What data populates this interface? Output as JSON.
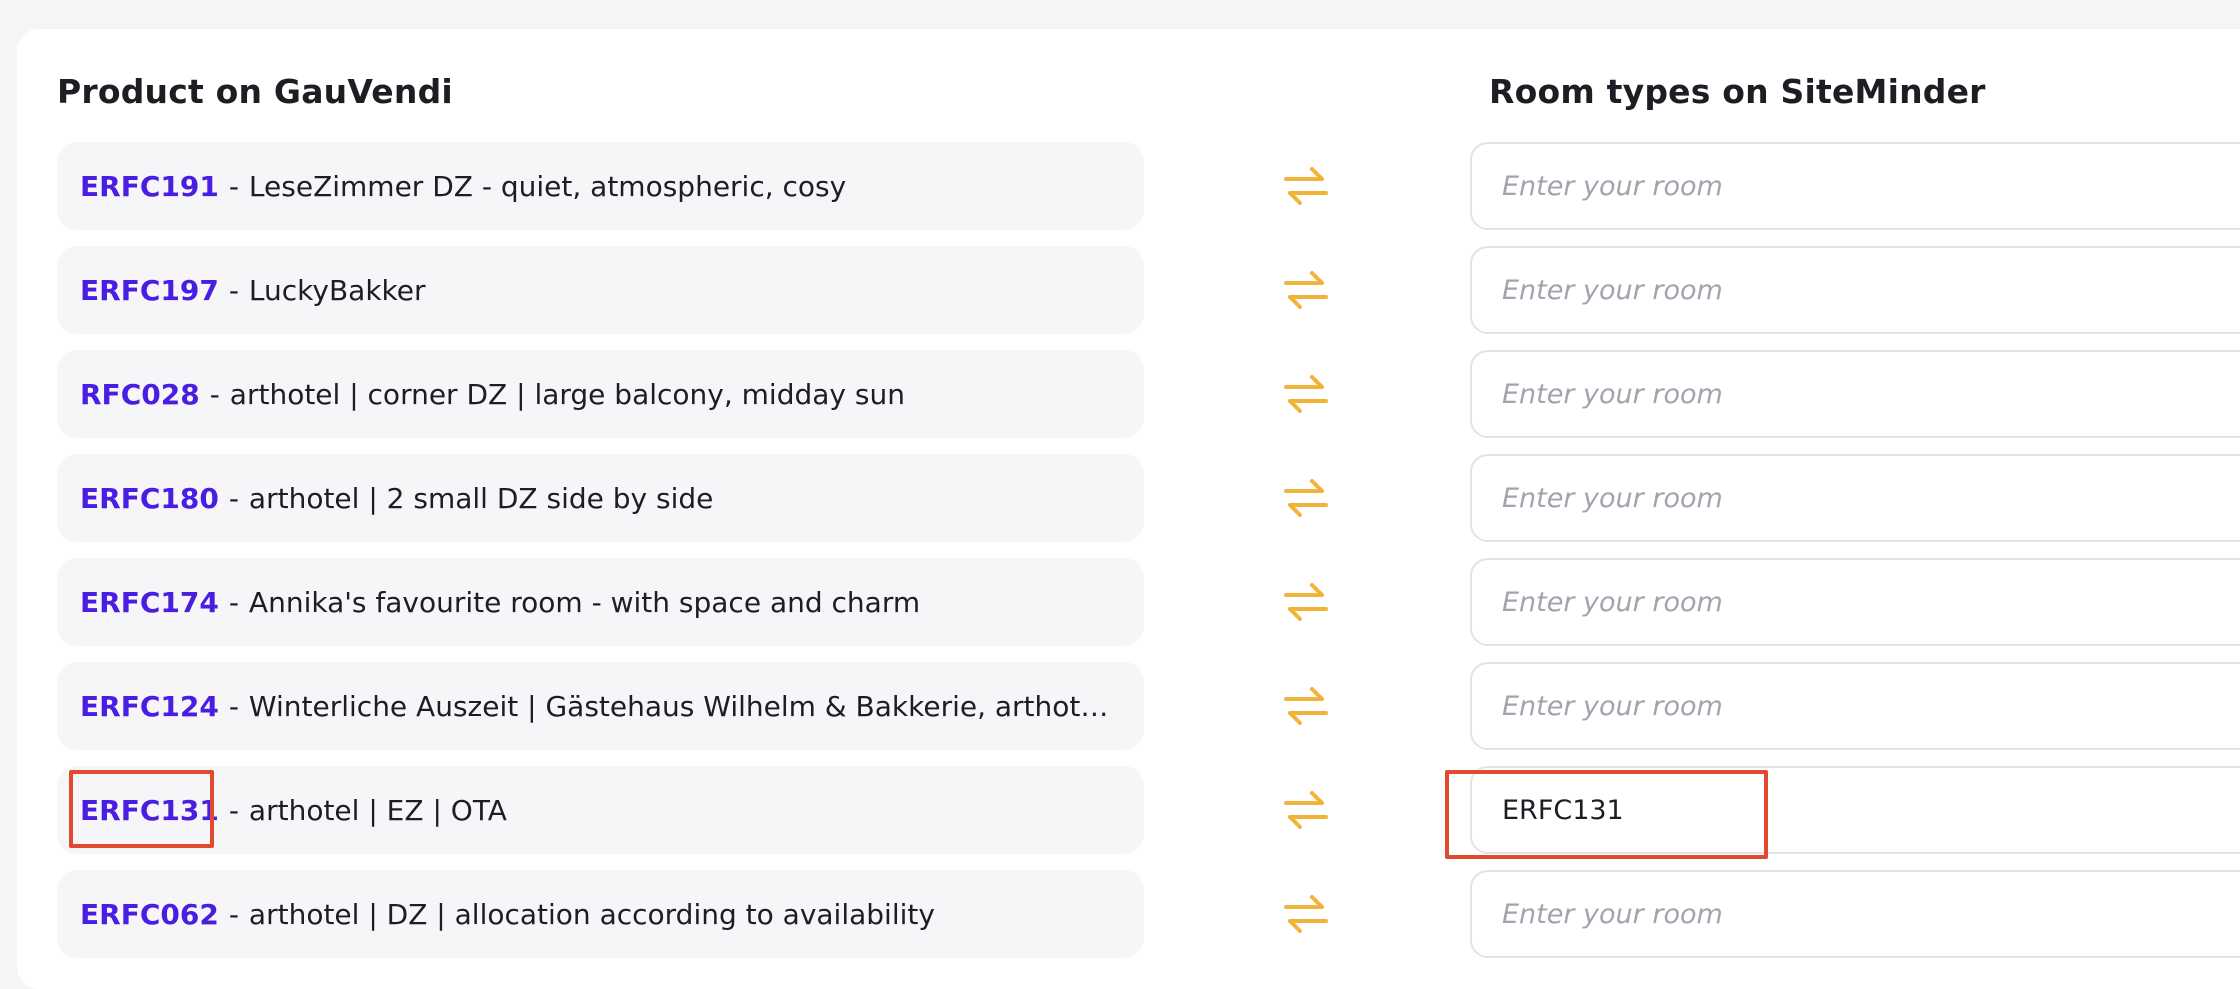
{
  "headings": {
    "left": "Product on GauVendi",
    "right": "Room types on SiteMinder"
  },
  "rows": [
    {
      "code": "ERFC191",
      "separator": "-",
      "name": "LeseZimmer DZ - quiet, atmospheric, cosy",
      "room_value": "",
      "room_placeholder": "Enter your room"
    },
    {
      "code": "ERFC197",
      "separator": "-",
      "name": "LuckyBakker",
      "room_value": "",
      "room_placeholder": "Enter your room"
    },
    {
      "code": "RFC028",
      "separator": "-",
      "name": "arthotel | corner DZ | large balcony, midday sun",
      "room_value": "",
      "room_placeholder": "Enter your room"
    },
    {
      "code": "ERFC180",
      "separator": "-",
      "name": "arthotel | 2 small DZ side by side",
      "room_value": "",
      "room_placeholder": "Enter your room"
    },
    {
      "code": "ERFC174",
      "separator": "-",
      "name": "Annika's favourite room - with space and charm",
      "room_value": "",
      "room_placeholder": "Enter your room"
    },
    {
      "code": "ERFC124",
      "separator": "-",
      "name": "Winterliche Auszeit | Gästehaus Wilhelm & Bakkerie, arthotel...",
      "room_value": "",
      "room_placeholder": "Enter your room"
    },
    {
      "code": "ERFC131",
      "separator": "-",
      "name": "arthotel | EZ | OTA",
      "room_value": "ERFC131",
      "room_placeholder": "Enter your room"
    },
    {
      "code": "ERFC062",
      "separator": "-",
      "name": "arthotel | DZ | allocation according to availability",
      "room_value": "",
      "room_placeholder": "Enter your room"
    }
  ],
  "icons": {
    "mapping": "swap-arrows-icon"
  },
  "colors": {
    "code": "#4a1ee0",
    "arrows": "#f0b43a",
    "highlight": "#e04a2f",
    "placeholder": "#a3a3ad"
  }
}
